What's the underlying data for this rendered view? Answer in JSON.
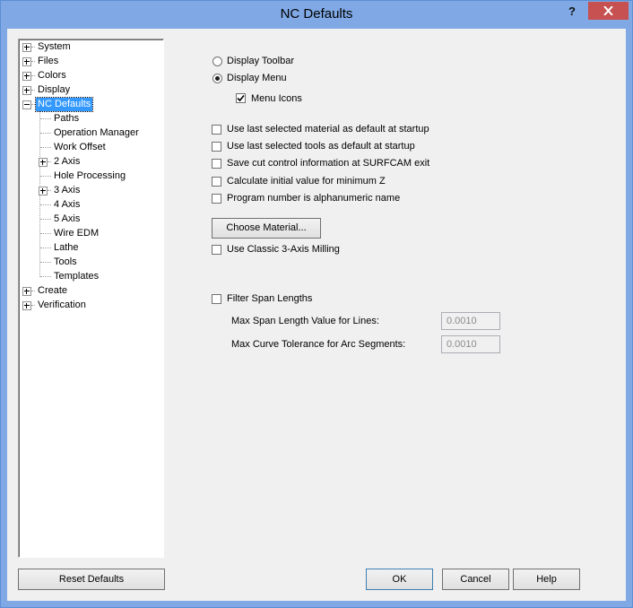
{
  "window": {
    "title": "NC Defaults",
    "help_glyph": "?",
    "close_icon": "close-icon"
  },
  "tree": {
    "items": [
      {
        "label": "System",
        "level": 0,
        "expander": "plus"
      },
      {
        "label": "Files",
        "level": 0,
        "expander": "plus"
      },
      {
        "label": "Colors",
        "level": 0,
        "expander": "plus"
      },
      {
        "label": "Display",
        "level": 0,
        "expander": "plus"
      },
      {
        "label": "NC Defaults",
        "level": 0,
        "expander": "minus",
        "selected": true
      },
      {
        "label": "Paths",
        "level": 1,
        "expander": "none"
      },
      {
        "label": "Operation Manager",
        "level": 1,
        "expander": "none"
      },
      {
        "label": "Work Offset",
        "level": 1,
        "expander": "none"
      },
      {
        "label": "2 Axis",
        "level": 1,
        "expander": "plus"
      },
      {
        "label": "Hole Processing",
        "level": 1,
        "expander": "none"
      },
      {
        "label": "3 Axis",
        "level": 1,
        "expander": "plus"
      },
      {
        "label": "4 Axis",
        "level": 1,
        "expander": "none"
      },
      {
        "label": "5 Axis",
        "level": 1,
        "expander": "none"
      },
      {
        "label": "Wire EDM",
        "level": 1,
        "expander": "none"
      },
      {
        "label": "Lathe",
        "level": 1,
        "expander": "none"
      },
      {
        "label": "Tools",
        "level": 1,
        "expander": "none"
      },
      {
        "label": "Templates",
        "level": 1,
        "expander": "none"
      },
      {
        "label": "Create",
        "level": 0,
        "expander": "plus"
      },
      {
        "label": "Verification",
        "level": 0,
        "expander": "plus"
      }
    ]
  },
  "display": {
    "toolbar_label": "Display Toolbar",
    "toolbar_selected": false,
    "menu_label": "Display Menu",
    "menu_selected": true,
    "menu_icons_label": "Menu Icons",
    "menu_icons_checked": true
  },
  "options": [
    {
      "label": "Use last selected material as default at startup",
      "checked": false
    },
    {
      "label": "Use last selected tools as default at startup",
      "checked": false
    },
    {
      "label": "Save cut control information at SURFCAM exit",
      "checked": false
    },
    {
      "label": "Calculate initial value for minimum Z",
      "checked": false
    },
    {
      "label": "Program number is alphanumeric name",
      "checked": false
    }
  ],
  "choose_material_label": "Choose Material...",
  "classic_milling": {
    "label": "Use Classic 3-Axis Milling",
    "checked": false
  },
  "span": {
    "filter_label": "Filter Span Lengths",
    "filter_checked": false,
    "lines_label": "Max Span Length Value for Lines:",
    "lines_value": "0.0010",
    "arc_label": "Max Curve Tolerance for Arc Segments:",
    "arc_value": "0.0010"
  },
  "buttons": {
    "reset": "Reset Defaults",
    "ok": "OK",
    "cancel": "Cancel",
    "help": "Help"
  },
  "colors": {
    "titlebar": "#7fa8e4",
    "close": "#c75050",
    "selection": "#3399ff"
  }
}
